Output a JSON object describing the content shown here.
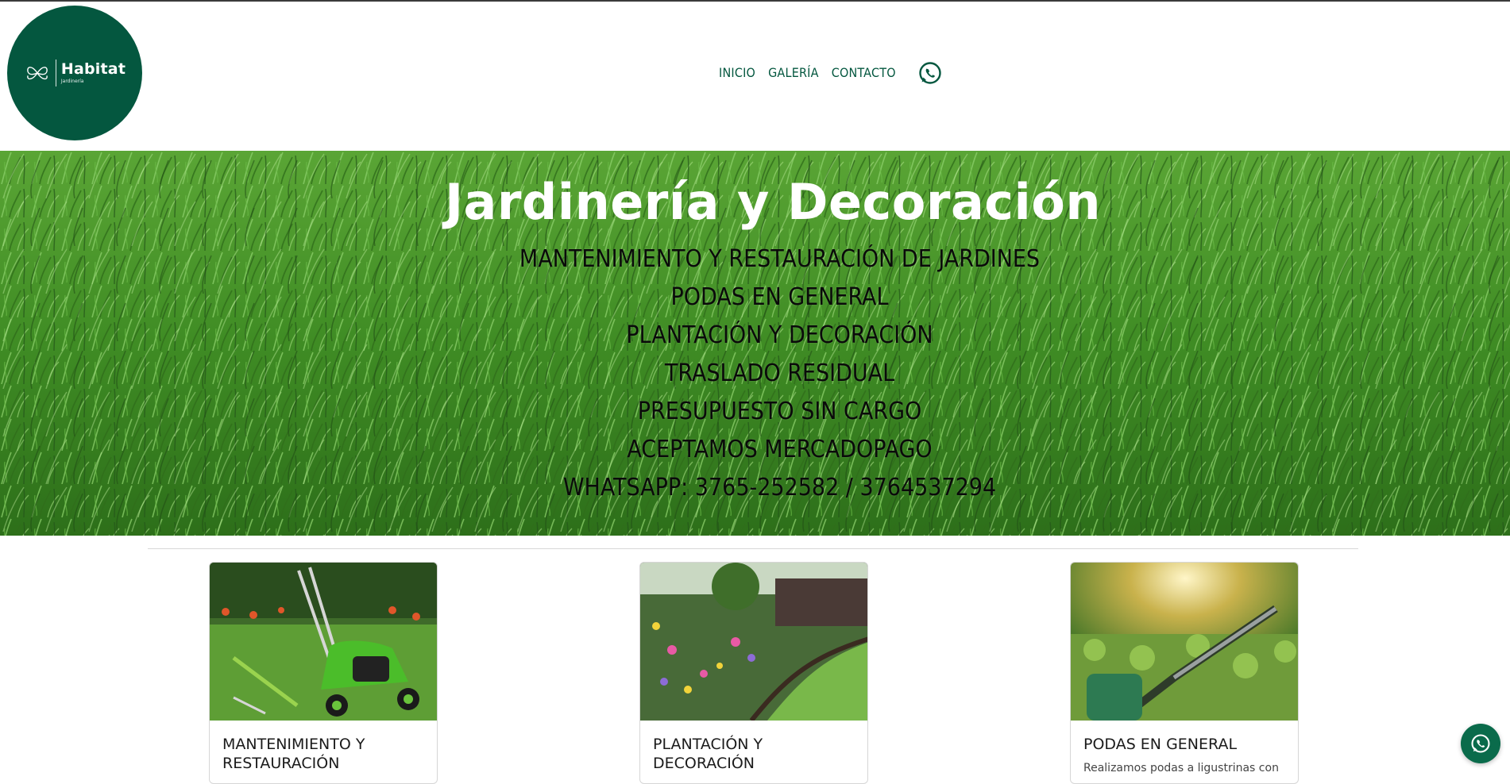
{
  "brand": {
    "name": "Habitat",
    "subtitle": "Jardinería",
    "color": "#04573f"
  },
  "nav": {
    "items": [
      {
        "label": "INICIO"
      },
      {
        "label": "GALERÍA"
      },
      {
        "label": "CONTACTO"
      }
    ],
    "whatsapp_icon": "whatsapp-icon"
  },
  "hero": {
    "title": "Jardinería y Decoración",
    "services": [
      "MANTENIMIENTO Y RESTAURACIÓN DE JARDINES",
      "PODAS EN GENERAL",
      "PLANTACIÓN Y DECORACIÓN",
      "TRASLADO RESIDUAL",
      "PRESUPUESTO SIN CARGO",
      "ACEPTAMOS MERCADOPAGO",
      "WHATSAPP: 3765-252582 / 3764537294"
    ]
  },
  "cards": [
    {
      "title": "MANTENIMIENTO Y RESTAURACIÓN",
      "description": ""
    },
    {
      "title": "PLANTACIÓN Y DECORACIÓN",
      "description": ""
    },
    {
      "title": "PODAS EN GENERAL",
      "description": "Realizamos podas a ligustrinas con"
    }
  ],
  "floating_button": {
    "icon": "whatsapp-icon",
    "color": "#0a6b4b"
  }
}
